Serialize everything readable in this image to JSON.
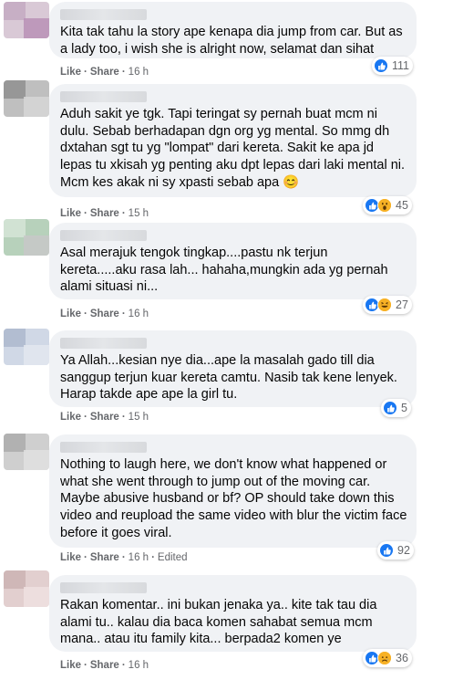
{
  "comments": [
    {
      "text": "Kita tak tahu la story ape kenapa dia jump from car. But as a lady too, i wish she is alright now, selamat dan sihat",
      "like_label": "Like",
      "share_label": "Share",
      "time": "16 h",
      "edited": "",
      "reactions": [
        "like"
      ],
      "reaction_count": "111"
    },
    {
      "text": "Aduh sakit ye tgk. Tapi teringat sy pernah buat mcm ni dulu. Sebab berhadapan dgn org yg mental. So mmg dh dxtahan sgt tu yg \"lompat\" dari kereta. Sakit ke apa jd lepas tu xkisah yg penting aku dpt lepas dari laki mental ni. Mcm kes akak ni sy xpasti sebab apa 😊",
      "like_label": "Like",
      "share_label": "Share",
      "time": "15 h",
      "edited": "",
      "reactions": [
        "like",
        "wow"
      ],
      "reaction_count": "45"
    },
    {
      "text": "Asal merajuk tengok tingkap....pastu nk terjun kereta.....aku rasa lah... hahaha,mungkin ada yg pernah alami situasi ni...",
      "like_label": "Like",
      "share_label": "Share",
      "time": "16 h",
      "edited": "",
      "reactions": [
        "like",
        "haha"
      ],
      "reaction_count": "27"
    },
    {
      "text": "Ya Allah...kesian nye dia...ape la masalah gado till dia sanggup terjun kuar kereta camtu. Nasib tak kene lenyek. Harap takde ape ape la girl tu.",
      "like_label": "Like",
      "share_label": "Share",
      "time": "15 h",
      "edited": "",
      "reactions": [
        "like"
      ],
      "reaction_count": "5"
    },
    {
      "text": "Nothing to laugh here, we don't know what happened or what she went through to jump out of the moving car. Maybe abusive husband or bf? OP should take down this video and reupload the same video with blur the victim face before it goes viral.",
      "like_label": "Like",
      "share_label": "Share",
      "time": "16 h",
      "edited": "Edited",
      "reactions": [
        "like"
      ],
      "reaction_count": "92"
    },
    {
      "text": "Rakan komentar.. ini bukan jenaka ya.. kite tak tau dia alami tu.. kalau dia baca komen sahabat semua mcm mana.. atau itu family kita... berpada2 komen ye",
      "like_label": "Like",
      "share_label": "Share",
      "time": "16 h",
      "edited": "",
      "reactions": [
        "like",
        "sad"
      ],
      "reaction_count": "36"
    }
  ],
  "colors": {
    "bubble": "#f0f2f5",
    "meta": "#65676b",
    "like_blue": "#1877f2",
    "emoji_yellow": "#f7b125"
  }
}
